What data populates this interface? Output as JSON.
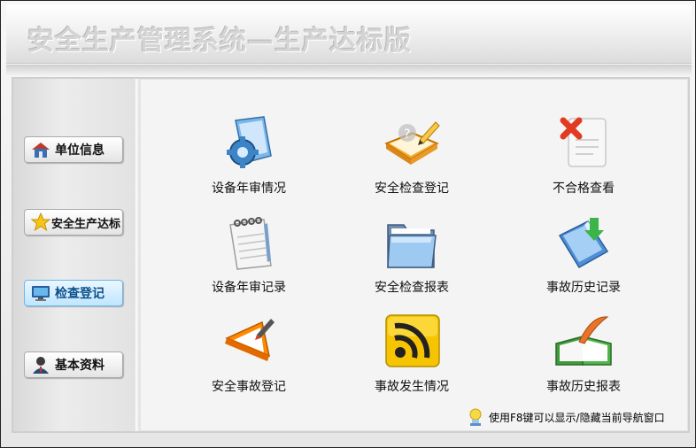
{
  "app": {
    "title": "安全生产管理系统—生产达标版"
  },
  "sidebar": {
    "items": [
      {
        "label": "单位信息",
        "icon": "house-icon"
      },
      {
        "label": "安全生产达标",
        "icon": "star-icon"
      },
      {
        "label": "检查登记",
        "icon": "monitor-icon",
        "active": true
      },
      {
        "label": "基本资料",
        "icon": "user-icon"
      }
    ]
  },
  "main": {
    "tiles": [
      {
        "label": "设备年审情况",
        "icon": "gear-folder-icon"
      },
      {
        "label": "安全检查登记",
        "icon": "book-pencil-icon"
      },
      {
        "label": "不合格查看",
        "icon": "error-document-icon"
      },
      {
        "label": "设备年审记录",
        "icon": "notepad-icon"
      },
      {
        "label": "安全检查报表",
        "icon": "folder-icon"
      },
      {
        "label": "事故历史记录",
        "icon": "download-folder-icon"
      },
      {
        "label": "安全事故登记",
        "icon": "edit-triangle-icon"
      },
      {
        "label": "事故发生情况",
        "icon": "rss-icon"
      },
      {
        "label": "事故历史报表",
        "icon": "open-book-icon"
      }
    ]
  },
  "hint": {
    "text": "使用F8键可以显示/隐藏当前导航窗口",
    "icon": "lightbulb-user-icon"
  }
}
